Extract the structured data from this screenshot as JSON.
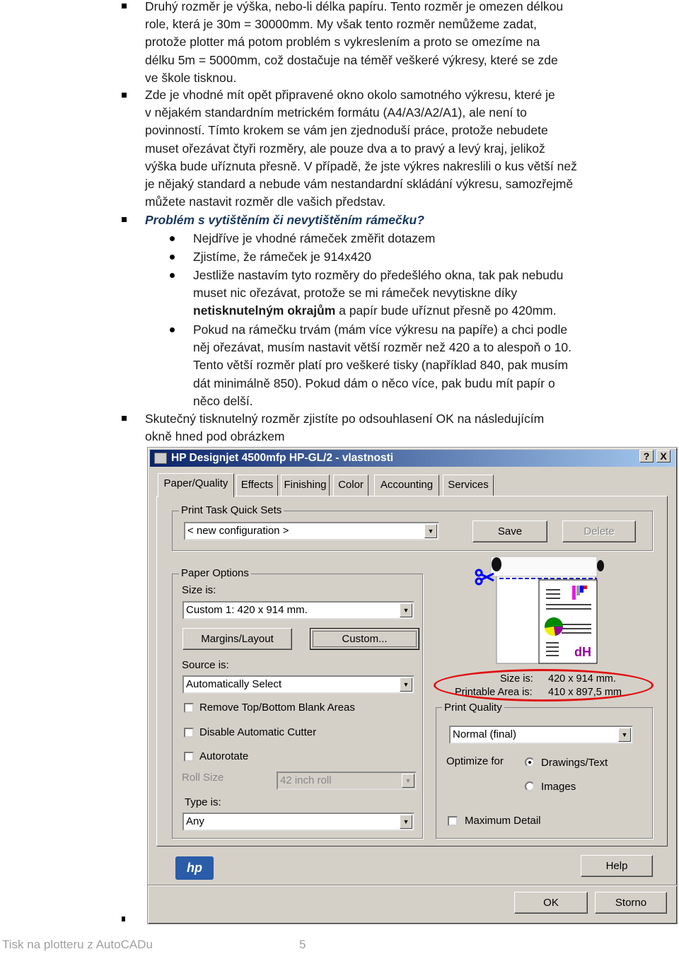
{
  "document": {
    "bullets_top": [
      {
        "lines": [
          "Druhý rozměr je výška, nebo-li délka papíru. Tento rozměr je omezen délkou",
          "role, která je 30m = 30000mm. My však tento rozměr nemůžeme zadat,",
          "protože plotter má potom problém s vykreslením a proto se omezíme na",
          "délku 5m = 5000mm, což dostačuje na téměř veškeré výkresy, které se zde",
          "ve škole tisknou."
        ]
      },
      {
        "lines": [
          "Zde je vhodné mít opět připravené okno okolo samotného výkresu, které je",
          "v nějakém standardním metrickém formátu (A4/A3/A2/A1), ale není to",
          "povinností. Tímto krokem se vám jen zjednoduší práce, protože nebudete",
          "muset ořezávat čtyři rozměry, ale pouze dva a to pravý a levý kraj, jelikož",
          "výška bude uříznuta přesně. V případě, že jste výkres nakreslili o kus větší než",
          "je nějaký standard a nebude vám nestandardní skládání výkresu, samozřejmě",
          "můžete nastavit rozměr dle vašich představ."
        ]
      }
    ],
    "heading": "Problém s vytištěním či nevytištěním rámečku?",
    "sub_bullets": [
      {
        "lines": [
          "Nejdříve je vhodné rámeček změřit dotazem"
        ]
      },
      {
        "lines": [
          "Zjistíme, že rámeček je 914x420"
        ]
      },
      {
        "lines": [
          "Jestliže nastavím tyto rozměry do předešlého okna, tak pak nebudu",
          "muset nic ořezávat, protože se mi rámeček nevytiskne díky"
        ],
        "bold": "netisknutelným okrajům",
        "after_bold": " a papír bude uříznut přesně po 420mm."
      },
      {
        "lines": [
          "Pokud na rámečku trvám (mám více výkresu na papíře) a chci podle",
          "něj ořezávat, musím nastavit větší rozměr než 420 a to alespoň o 10.",
          "Tento větší rozměr platí pro veškeré tisky (například 840, pak musím",
          "dát minimálně 850). Pokud dám o něco více, pak budu mít papír o",
          "něco delší."
        ]
      }
    ],
    "last_bullet": {
      "lines": [
        "Skutečný tisknutelný rozměr zjistíte po odsouhlasení OK na následujícím",
        "okně hned pod obrázkem"
      ]
    }
  },
  "dialog": {
    "title": "HP Designjet 4500mfp HP-GL/2 - vlastnosti",
    "help_btn": "?",
    "close_btn": "X",
    "tabs": [
      "Paper/Quality",
      "Effects",
      "Finishing",
      "Color",
      "Accounting",
      "Services"
    ],
    "active_tab": "Paper/Quality",
    "quick_sets": {
      "label": "Print Task Quick Sets",
      "value": "< new configuration >",
      "save": "Save",
      "delete": "Delete"
    },
    "paper_options": {
      "label": "Paper Options",
      "size_label": "Size is:",
      "size_value": "Custom 1:  420  x  914 mm.",
      "margins_btn": "Margins/Layout",
      "custom_btn": "Custom...",
      "source_label": "Source is:",
      "source_value": "Automatically Select",
      "remove_blank": "Remove Top/Bottom Blank Areas",
      "disable_cutter": "Disable Automatic Cutter",
      "autorotate": "Autorotate",
      "roll_size_label": "Roll Size",
      "roll_size_value": "42 inch roll",
      "type_label": "Type is:",
      "type_value": "Any"
    },
    "size_info": {
      "size_label": "Size is:",
      "size_value": "420  x  914 mm.",
      "printable_label": "Printable Area is:",
      "printable_value": "410  x  897,5 mm"
    },
    "highlight_color": "#e01010",
    "print_quality": {
      "label": "Print Quality",
      "value": "Normal (final)",
      "optimize_label": "Optimize for",
      "options": [
        "Drawings/Text",
        "Images"
      ],
      "selected": "Drawings/Text",
      "max_detail": "Maximum Detail"
    },
    "help": "Help",
    "ok": "OK",
    "cancel": "Storno"
  },
  "footer": {
    "title": "Tisk na plotteru z AutoCADu",
    "page": "5"
  }
}
